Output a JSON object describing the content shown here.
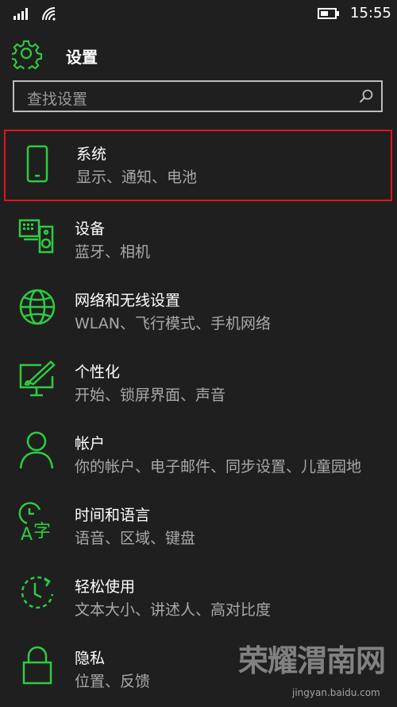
{
  "status_bar": {
    "time": "15:55",
    "icons": [
      "signal-icon",
      "wifi-icon",
      "battery-icon"
    ]
  },
  "header": {
    "title": "设置",
    "icon": "gear-icon"
  },
  "search": {
    "placeholder": "查找设置",
    "icon": "search-icon"
  },
  "accent_color": "#2ecc40",
  "selection_color": "#e0141e",
  "items": [
    {
      "name": "系统",
      "desc": "显示、通知、电池",
      "icon": "phone-icon",
      "selected": true
    },
    {
      "name": "设备",
      "desc": "蓝牙、相机",
      "icon": "devices-icon"
    },
    {
      "name": "网络和无线设置",
      "desc": "WLAN、飞行模式、手机网络",
      "icon": "globe-icon"
    },
    {
      "name": "个性化",
      "desc": "开始、锁屏界面、声音",
      "icon": "paint-monitor-icon"
    },
    {
      "name": "帐户",
      "desc": "你的帐户、电子邮件、同步设置、儿童园地",
      "icon": "person-icon"
    },
    {
      "name": "时间和语言",
      "desc": "语音、区域、键盘",
      "icon": "clock-language-icon"
    },
    {
      "name": "轻松使用",
      "desc": "文本大小、讲述人、高对比度",
      "icon": "ease-of-access-icon"
    },
    {
      "name": "隐私",
      "desc": "位置、反馈",
      "icon": "lock-icon"
    }
  ],
  "watermark": {
    "text": "荣耀渭南网",
    "site": "jingyan.baidu.com"
  }
}
